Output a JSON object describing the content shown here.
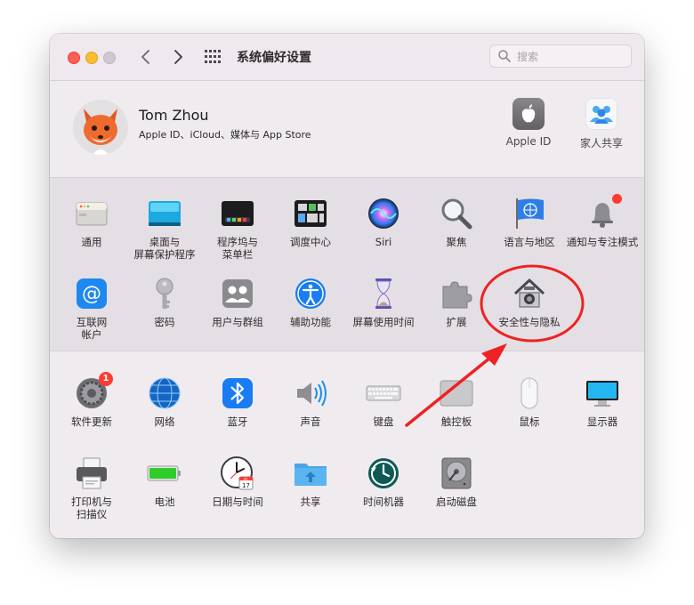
{
  "window": {
    "title": "系统偏好设置"
  },
  "search": {
    "placeholder": "搜索"
  },
  "user": {
    "name": "Tom Zhou",
    "subtitle": "Apple ID、iCloud、媒体与 App Store"
  },
  "account_items": [
    {
      "label": "Apple ID",
      "icon": "apple-logo-icon"
    },
    {
      "label": "家人共享",
      "icon": "family-icon"
    }
  ],
  "panes_row1": [
    {
      "label": "通用",
      "icon": "general-icon"
    },
    {
      "label": "桌面与\n屏幕保护程序",
      "icon": "desktop-icon"
    },
    {
      "label": "程序坞与\n菜单栏",
      "icon": "dock-icon"
    },
    {
      "label": "调度中心",
      "icon": "mission-control-icon"
    },
    {
      "label": "Siri",
      "icon": "siri-icon"
    },
    {
      "label": "聚焦",
      "icon": "spotlight-icon"
    },
    {
      "label": "语言与地区",
      "icon": "language-flag-icon"
    },
    {
      "label": "通知与专注模式",
      "icon": "bell-icon"
    }
  ],
  "panes_row2": [
    {
      "label": "互联网\n帐户",
      "icon": "at-icon"
    },
    {
      "label": "密码",
      "icon": "key-icon"
    },
    {
      "label": "用户与群组",
      "icon": "users-icon"
    },
    {
      "label": "辅助功能",
      "icon": "accessibility-icon"
    },
    {
      "label": "屏幕使用时间",
      "icon": "hourglass-icon"
    },
    {
      "label": "扩展",
      "icon": "puzzle-icon"
    },
    {
      "label": "安全性与隐私",
      "icon": "house-lock-icon"
    }
  ],
  "panes_row3": [
    {
      "label": "软件更新",
      "icon": "gear-icon",
      "badge": "1"
    },
    {
      "label": "网络",
      "icon": "globe-icon"
    },
    {
      "label": "蓝牙",
      "icon": "bluetooth-icon"
    },
    {
      "label": "声音",
      "icon": "speaker-icon"
    },
    {
      "label": "键盘",
      "icon": "keyboard-icon"
    },
    {
      "label": "触控板",
      "icon": "trackpad-icon"
    },
    {
      "label": "鼠标",
      "icon": "mouse-icon"
    },
    {
      "label": "显示器",
      "icon": "display-icon"
    }
  ],
  "panes_row4": [
    {
      "label": "打印机与\n扫描仪",
      "icon": "printer-icon"
    },
    {
      "label": "电池",
      "icon": "battery-icon"
    },
    {
      "label": "日期与时间",
      "icon": "clock-icon",
      "calendar_text": "JUL",
      "calendar_day": "17"
    },
    {
      "label": "共享",
      "icon": "folder-share-icon"
    },
    {
      "label": "时间机器",
      "icon": "time-machine-icon"
    },
    {
      "label": "启动磁盘",
      "icon": "disk-icon"
    }
  ],
  "colors": {
    "annotation": "#ee2222",
    "accent": "#1a7cf2"
  }
}
